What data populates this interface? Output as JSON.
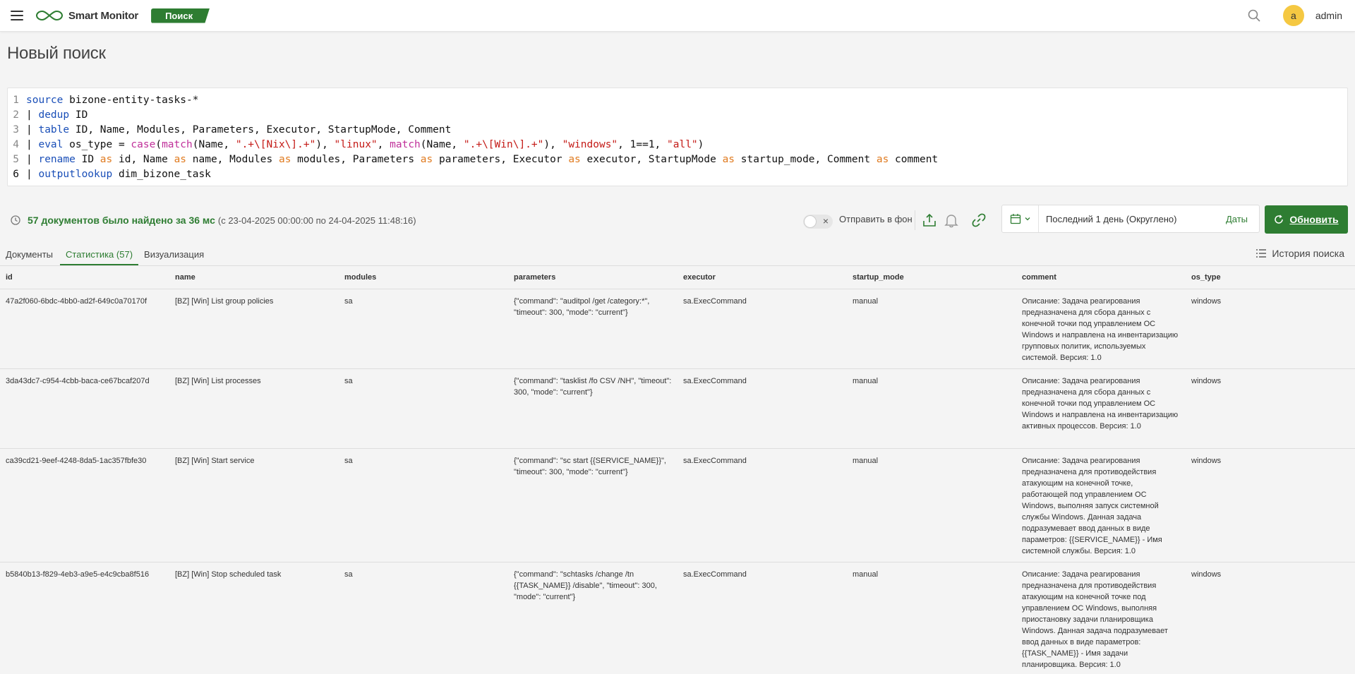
{
  "header": {
    "app_name": "Smart Monitor",
    "section_badge": "Поиск",
    "avatar_letter": "a",
    "username": "admin"
  },
  "page": {
    "title": "Новый поиск"
  },
  "editor": {
    "lines": [
      {
        "n": "1",
        "html": "<span class=\"kw\">source</span> bizone-entity-tasks-*"
      },
      {
        "n": "2",
        "html": "| <span class=\"kw\">dedup</span> ID"
      },
      {
        "n": "3",
        "html": "| <span class=\"kw\">table</span> ID, Name, Modules, Parameters, Executor, StartupMode, Comment"
      },
      {
        "n": "4",
        "html": "| <span class=\"kw\">eval</span> os_type = <span class=\"fn\">case</span>(<span class=\"fn\">match</span>(Name, <span class=\"str\">\".+\\[Nix\\].+\"</span>), <span class=\"str\">\"linux\"</span>, <span class=\"fn\">match</span>(Name, <span class=\"str\">\".+\\[Win\\].+\"</span>), <span class=\"str\">\"windows\"</span>, 1==1, <span class=\"str\">\"all\"</span>)"
      },
      {
        "n": "5",
        "html": "| <span class=\"kw\">rename</span> ID <span class=\"as\">as</span> id, Name <span class=\"as\">as</span> name, Modules <span class=\"as\">as</span> modules, Parameters <span class=\"as\">as</span> parameters, Executor <span class=\"as\">as</span> executor, StartupMode <span class=\"as\">as</span> startup_mode, Comment <span class=\"as\">as</span> comment"
      },
      {
        "n": "6",
        "html": "| <span class=\"kw\">outputlookup</span> dim_bizone_task"
      }
    ]
  },
  "status": {
    "found_text": "57 документов было найдено за 36 мс",
    "range_text": "(с 23-04-2025 00:00:00 по 24-04-2025 11:48:16)",
    "background_label": "Отправить в фон",
    "date_range_text": "Последний 1 день (Округлено)",
    "dates_link": "Даты",
    "refresh_label": "Обновить"
  },
  "tabs": [
    {
      "label": "Документы",
      "active": false
    },
    {
      "label": "Статистика (57)",
      "active": true
    },
    {
      "label": "Визуализация",
      "active": false
    }
  ],
  "history_label": "История поиска",
  "table": {
    "columns": [
      "id",
      "name",
      "modules",
      "parameters",
      "executor",
      "startup_mode",
      "comment",
      "os_type"
    ],
    "rows": [
      {
        "id": "47a2f060-6bdc-4bb0-ad2f-649c0a70170f",
        "name": "[BZ] [Win] List group policies",
        "modules": "sa",
        "parameters": "{\"command\": \"auditpol /get /category:*\", \"timeout\": 300, \"mode\": \"current\"}",
        "executor": "sa.ExecCommand",
        "startup_mode": "manual",
        "comment": "Описание: Задача реагирования предназначена для сбора данных с конечной точки под управлением ОС Windows и направлена на инвентаризацию групповых политик, используемых системой. Версия: 1.0",
        "os_type": "windows",
        "height": 113
      },
      {
        "id": "3da43dc7-c954-4cbb-baca-ce67bcaf207d",
        "name": "[BZ] [Win] List processes",
        "modules": "sa",
        "parameters": "{\"command\": \"tasklist /fo CSV /NH\", \"timeout\": 300, \"mode\": \"current\"}",
        "executor": "sa.ExecCommand",
        "startup_mode": "manual",
        "comment": "Описание: Задача реагирования предназначена для сбора данных с конечной точки под управлением ОС Windows и направлена на инвентаризацию активных процессов. Версия: 1.0",
        "os_type": "windows",
        "height": 113
      },
      {
        "id": "ca39cd21-9eef-4248-8da5-1ac357fbfe30",
        "name": "[BZ] [Win] Start service",
        "modules": "sa",
        "parameters": "{\"command\": \"sc start {{SERVICE_NAME}}\", \"timeout\": 300, \"mode\": \"current\"}",
        "executor": "sa.ExecCommand",
        "startup_mode": "manual",
        "comment": "Описание: Задача реагирования предназначена для противодействия атакующим на конечной точке, работающей под управлением ОС Windows, выполняя запуск системной службы Windows. Данная задача подразумевает ввод данных в виде параметров: {{SERVICE_NAME}} - Имя системной службы. Версия: 1.0",
        "os_type": "windows",
        "height": 161
      },
      {
        "id": "b5840b13-f829-4eb3-a9e5-e4c9cba8f516",
        "name": "[BZ] [Win] Stop scheduled task",
        "modules": "sa",
        "parameters": "{\"command\": \"schtasks /change /tn {{TASK_NAME}} /disable\", \"timeout\": 300, \"mode\": \"current\"}",
        "executor": "sa.ExecCommand",
        "startup_mode": "manual",
        "comment": "Описание: Задача реагирования предназначена для противодействия атакующим на конечной точке под управлением ОС Windows, выполняя приостановку задачи планировщика Windows. Данная задача подразумевает ввод данных в виде параметров: {{TASK_NAME}} - Имя задачи планировщика. Версия: 1.0",
        "os_type": "windows",
        "height": 170
      }
    ]
  },
  "colors": {
    "accent": "#2e7d32",
    "avatar": "#f5c842"
  },
  "icons": [
    "menu-icon",
    "logo-icon",
    "search-icon",
    "clock-icon",
    "export-icon",
    "bell-icon",
    "link-icon",
    "calendar-icon",
    "chevron-down-icon",
    "refresh-icon",
    "history-list-icon"
  ]
}
